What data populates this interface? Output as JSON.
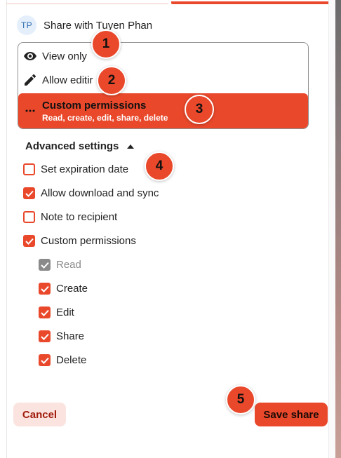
{
  "colors": {
    "accent": "#e9482b",
    "cancel_bg": "#fbe3df",
    "avatar_bg": "#e4effb"
  },
  "share": {
    "avatar_initials": "TP",
    "title": "Share with Tuyen Phan"
  },
  "permissions": {
    "view_label": "View only",
    "view_icon": "eye-icon",
    "edit_label": "Allow editir",
    "edit_icon": "pencil-icon",
    "custom_label": "Custom permissions",
    "custom_sublabel": "Read, create, edit, share, delete",
    "custom_icon": "more-horizontal-icon"
  },
  "advanced": {
    "label": "Advanced settings",
    "expanded": true
  },
  "options": [
    {
      "label": "Set expiration date",
      "checked": false
    },
    {
      "label": "Allow download and sync",
      "checked": true
    },
    {
      "label": "Note to recipient",
      "checked": false
    },
    {
      "label": "Custom permissions",
      "checked": true
    }
  ],
  "custom_options": [
    {
      "label": "Read",
      "checked": true,
      "disabled": true
    },
    {
      "label": "Create",
      "checked": true,
      "disabled": false
    },
    {
      "label": "Edit",
      "checked": true,
      "disabled": false
    },
    {
      "label": "Share",
      "checked": true,
      "disabled": false
    },
    {
      "label": "Delete",
      "checked": true,
      "disabled": false
    }
  ],
  "buttons": {
    "cancel": "Cancel",
    "save": "Save share"
  },
  "step_badges": [
    "1",
    "2",
    "3",
    "4",
    "5"
  ]
}
